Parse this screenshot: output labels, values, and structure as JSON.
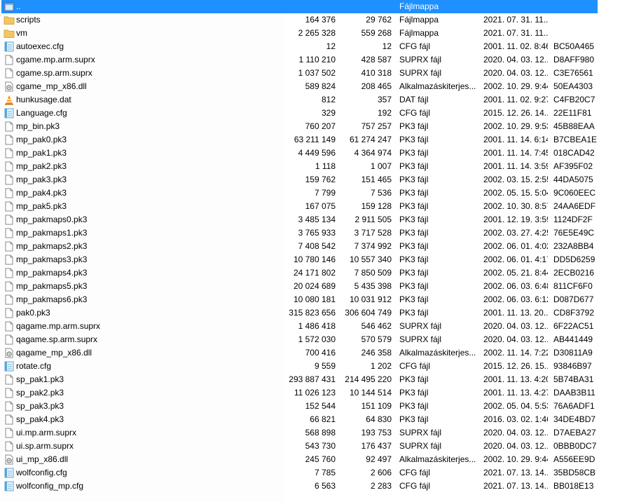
{
  "rows": [
    {
      "name": "..",
      "size": "",
      "packed": "",
      "type": "Fájlmappa",
      "date": "",
      "crc": "",
      "icon": "folder-up-icon",
      "selected": true
    },
    {
      "name": "scripts",
      "size": "164 376",
      "packed": "29 762",
      "type": "Fájlmappa",
      "date": "2021. 07. 31. 11...",
      "crc": "",
      "icon": "folder-icon"
    },
    {
      "name": "vm",
      "size": "2 265 328",
      "packed": "559 268",
      "type": "Fájlmappa",
      "date": "2021. 07. 31. 11...",
      "crc": "",
      "icon": "folder-icon"
    },
    {
      "name": "autoexec.cfg",
      "size": "12",
      "packed": "12",
      "type": "CFG fájl",
      "date": "2001. 11. 02. 8:46",
      "crc": "BC50A465",
      "icon": "notepad-file-icon"
    },
    {
      "name": "cgame.mp.arm.suprx",
      "size": "1 110 210",
      "packed": "428 587",
      "type": "SUPRX fájl",
      "date": "2020. 04. 03. 12...",
      "crc": "D8AFF980",
      "icon": "generic-file-icon"
    },
    {
      "name": "cgame.sp.arm.suprx",
      "size": "1 037 502",
      "packed": "410 318",
      "type": "SUPRX fájl",
      "date": "2020. 04. 03. 12...",
      "crc": "C3E76561",
      "icon": "generic-file-icon"
    },
    {
      "name": "cgame_mp_x86.dll",
      "size": "589 824",
      "packed": "208 465",
      "type": "Alkalmazáskiterjes...",
      "date": "2002. 10. 29. 9:44",
      "crc": "50EA4303",
      "icon": "dll-file-icon"
    },
    {
      "name": "hunkusage.dat",
      "size": "812",
      "packed": "357",
      "type": "DAT fájl",
      "date": "2001. 11. 02. 9:27",
      "crc": "C4FB20C7",
      "icon": "vlc-cone-icon"
    },
    {
      "name": "Language.cfg",
      "size": "329",
      "packed": "192",
      "type": "CFG fájl",
      "date": "2015. 12. 26. 14...",
      "crc": "22E11F81",
      "icon": "notepad-file-icon"
    },
    {
      "name": "mp_bin.pk3",
      "size": "760 207",
      "packed": "757 257",
      "type": "PK3 fájl",
      "date": "2002. 10. 29. 9:53",
      "crc": "45B88EAA",
      "icon": "generic-file-icon"
    },
    {
      "name": "mp_pak0.pk3",
      "size": "63 211 149",
      "packed": "61 274 247",
      "type": "PK3 fájl",
      "date": "2001. 11. 14. 6:14",
      "crc": "B7CBEA1E",
      "icon": "generic-file-icon"
    },
    {
      "name": "mp_pak1.pk3",
      "size": "4 449 596",
      "packed": "4 364 974",
      "type": "PK3 fájl",
      "date": "2001. 11. 14. 7:45",
      "crc": "018CAD42",
      "icon": "generic-file-icon"
    },
    {
      "name": "mp_pak2.pk3",
      "size": "1 118",
      "packed": "1 007",
      "type": "PK3 fájl",
      "date": "2001. 11. 14. 3:59",
      "crc": "AF395F02",
      "icon": "generic-file-icon"
    },
    {
      "name": "mp_pak3.pk3",
      "size": "159 762",
      "packed": "151 465",
      "type": "PK3 fájl",
      "date": "2002. 03. 15. 2:55",
      "crc": "44DA5075",
      "icon": "generic-file-icon"
    },
    {
      "name": "mp_pak4.pk3",
      "size": "7 799",
      "packed": "7 536",
      "type": "PK3 fájl",
      "date": "2002. 05. 15. 5:04",
      "crc": "9C060EEC",
      "icon": "generic-file-icon"
    },
    {
      "name": "mp_pak5.pk3",
      "size": "167 075",
      "packed": "159 128",
      "type": "PK3 fájl",
      "date": "2002. 10. 30. 8:57",
      "crc": "24AA6EDF",
      "icon": "generic-file-icon"
    },
    {
      "name": "mp_pakmaps0.pk3",
      "size": "3 485 134",
      "packed": "2 911 505",
      "type": "PK3 fájl",
      "date": "2001. 12. 19. 3:59",
      "crc": "1124DF2F",
      "icon": "generic-file-icon"
    },
    {
      "name": "mp_pakmaps1.pk3",
      "size": "3 765 933",
      "packed": "3 717 528",
      "type": "PK3 fájl",
      "date": "2002. 03. 27. 4:25",
      "crc": "76E5E49C",
      "icon": "generic-file-icon"
    },
    {
      "name": "mp_pakmaps2.pk3",
      "size": "7 408 542",
      "packed": "7 374 992",
      "type": "PK3 fájl",
      "date": "2002. 06. 01. 4:02",
      "crc": "232A8BB4",
      "icon": "generic-file-icon"
    },
    {
      "name": "mp_pakmaps3.pk3",
      "size": "10 780 146",
      "packed": "10 557 340",
      "type": "PK3 fájl",
      "date": "2002. 06. 01. 4:17",
      "crc": "DD5D6259",
      "icon": "generic-file-icon"
    },
    {
      "name": "mp_pakmaps4.pk3",
      "size": "24 171 802",
      "packed": "7 850 509",
      "type": "PK3 fájl",
      "date": "2002. 05. 21. 8:44",
      "crc": "2ECB0216",
      "icon": "generic-file-icon"
    },
    {
      "name": "mp_pakmaps5.pk3",
      "size": "20 024 689",
      "packed": "5 435 398",
      "type": "PK3 fájl",
      "date": "2002. 06. 03. 6:48",
      "crc": "811CF6F0",
      "icon": "generic-file-icon"
    },
    {
      "name": "mp_pakmaps6.pk3",
      "size": "10 080 181",
      "packed": "10 031 912",
      "type": "PK3 fájl",
      "date": "2002. 06. 03. 6:12",
      "crc": "D087D677",
      "icon": "generic-file-icon"
    },
    {
      "name": "pak0.pk3",
      "size": "315 823 656",
      "packed": "306 604 749",
      "type": "PK3 fájl",
      "date": "2001. 11. 13. 20...",
      "crc": "CD8F3792",
      "icon": "generic-file-icon"
    },
    {
      "name": "qagame.mp.arm.suprx",
      "size": "1 486 418",
      "packed": "546 462",
      "type": "SUPRX fájl",
      "date": "2020. 04. 03. 12...",
      "crc": "6F22AC51",
      "icon": "generic-file-icon"
    },
    {
      "name": "qagame.sp.arm.suprx",
      "size": "1 572 030",
      "packed": "570 579",
      "type": "SUPRX fájl",
      "date": "2020. 04. 03. 12...",
      "crc": "AB441449",
      "icon": "generic-file-icon"
    },
    {
      "name": "qagame_mp_x86.dll",
      "size": "700 416",
      "packed": "246 358",
      "type": "Alkalmazáskiterjes...",
      "date": "2002. 11. 14. 7:22",
      "crc": "D30811A9",
      "icon": "dll-file-icon"
    },
    {
      "name": "rotate.cfg",
      "size": "9 559",
      "packed": "1 202",
      "type": "CFG fájl",
      "date": "2015. 12. 26. 15...",
      "crc": "93846B97",
      "icon": "notepad-file-icon"
    },
    {
      "name": "sp_pak1.pk3",
      "size": "293 887 431",
      "packed": "214 495 220",
      "type": "PK3 fájl",
      "date": "2001. 11. 13. 4:20",
      "crc": "5B74BA31",
      "icon": "generic-file-icon"
    },
    {
      "name": "sp_pak2.pk3",
      "size": "11 026 123",
      "packed": "10 144 514",
      "type": "PK3 fájl",
      "date": "2001. 11. 13. 4:27",
      "crc": "DAAB3B11",
      "icon": "generic-file-icon"
    },
    {
      "name": "sp_pak3.pk3",
      "size": "152 544",
      "packed": "151 109",
      "type": "PK3 fájl",
      "date": "2002. 05. 04. 5:53",
      "crc": "76A6ADF1",
      "icon": "generic-file-icon"
    },
    {
      "name": "sp_pak4.pk3",
      "size": "66 821",
      "packed": "64 830",
      "type": "PK3 fájl",
      "date": "2016. 03. 02. 1:46",
      "crc": "34DE4BD7",
      "icon": "generic-file-icon"
    },
    {
      "name": "ui.mp.arm.suprx",
      "size": "568 898",
      "packed": "193 753",
      "type": "SUPRX fájl",
      "date": "2020. 04. 03. 12...",
      "crc": "D7AEBA27",
      "icon": "generic-file-icon"
    },
    {
      "name": "ui.sp.arm.suprx",
      "size": "543 730",
      "packed": "176 437",
      "type": "SUPRX fájl",
      "date": "2020. 04. 03. 12...",
      "crc": "0BBB0DC7",
      "icon": "generic-file-icon"
    },
    {
      "name": "ui_mp_x86.dll",
      "size": "245 760",
      "packed": "92 497",
      "type": "Alkalmazáskiterjes...",
      "date": "2002. 10. 29. 9:44",
      "crc": "A556EE9D",
      "icon": "dll-file-icon"
    },
    {
      "name": "wolfconfig.cfg",
      "size": "7 785",
      "packed": "2 606",
      "type": "CFG fájl",
      "date": "2021. 07. 13. 14...",
      "crc": "35BD58CB",
      "icon": "notepad-file-icon"
    },
    {
      "name": "wolfconfig_mp.cfg",
      "size": "6 563",
      "packed": "2 283",
      "type": "CFG fájl",
      "date": "2021. 07. 13. 14...",
      "crc": "BB018E13",
      "icon": "notepad-file-icon"
    }
  ],
  "colors": {
    "selection": "#1e90ff",
    "folder": "#f3c75f",
    "vlc": "#ff8800",
    "notepad": "#5aa6d6"
  }
}
